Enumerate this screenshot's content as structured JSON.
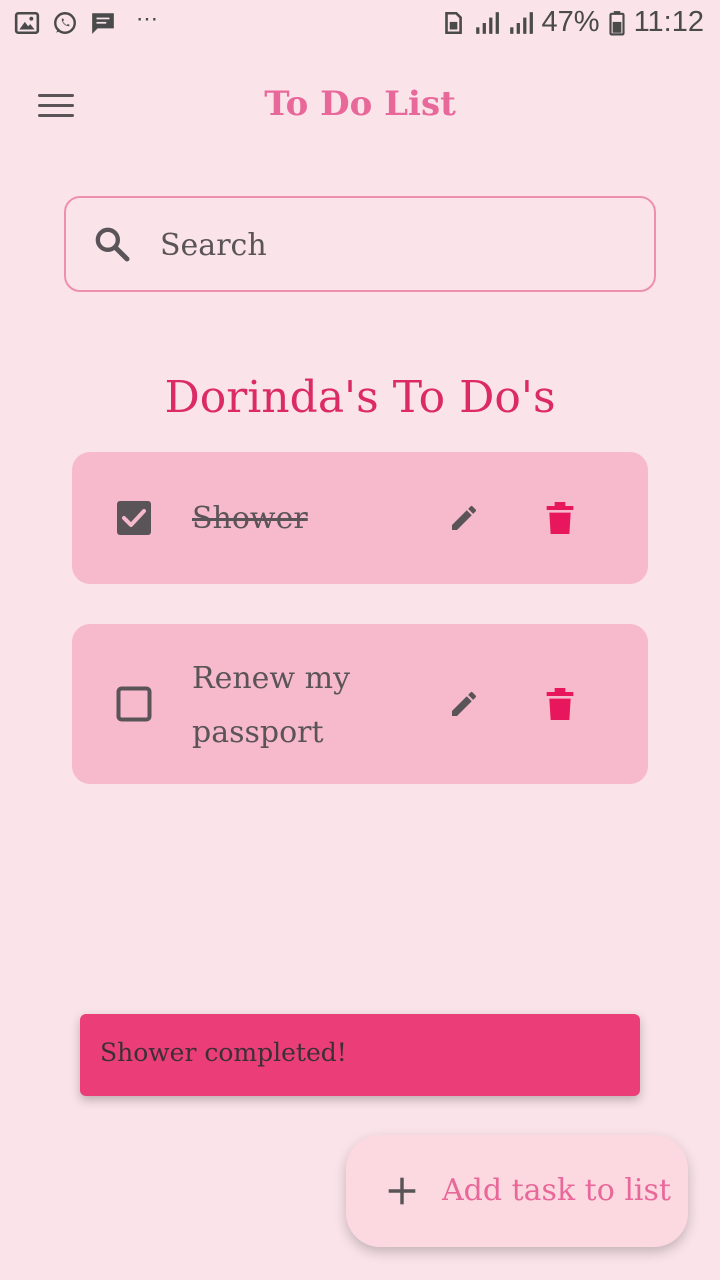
{
  "status_bar": {
    "battery": "47%",
    "time": "11:12",
    "dots": "⋯",
    "left_icons": [
      "gallery-icon",
      "whatsapp-icon",
      "message-icon"
    ],
    "right_icons": [
      "sim-icon",
      "signal-icon",
      "signal-icon",
      "battery-icon"
    ]
  },
  "app_bar": {
    "title": "To Do List",
    "menu_icon": "hamburger-menu-icon"
  },
  "search": {
    "placeholder": "Search",
    "value": ""
  },
  "list": {
    "title": "Dorinda's To Do's",
    "tasks": [
      {
        "label": "Shower",
        "completed": true
      },
      {
        "label": "Renew my passport",
        "completed": false
      }
    ]
  },
  "snackbar": {
    "message": "Shower completed!"
  },
  "fab": {
    "label": "Add task to list",
    "icon": "plus-icon"
  },
  "colors": {
    "background": "#fae4ea",
    "accent": "#e8689a",
    "heading": "#dc2a66",
    "card": "#f7bacd",
    "delete": "#e8175d",
    "snackbar": "#eb3e78",
    "fab": "#fcd9e0"
  }
}
